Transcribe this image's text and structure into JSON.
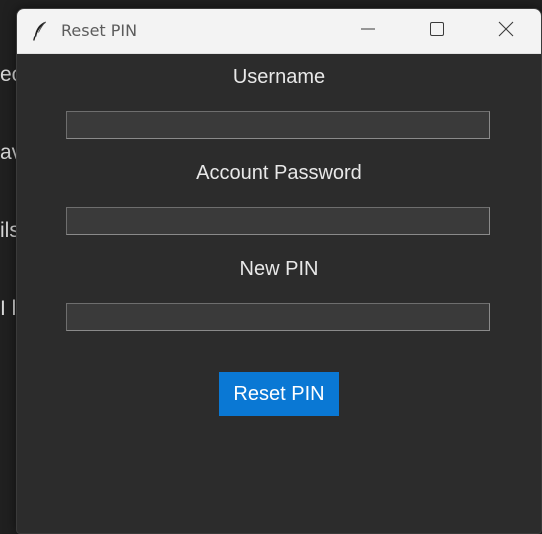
{
  "background": {
    "text_lines": [
      "ec",
      "av",
      "ils",
      "I l"
    ]
  },
  "window": {
    "title": "Reset PIN",
    "app_icon": "feather-icon",
    "controls": {
      "minimize": "minimize-icon",
      "maximize": "maximize-icon",
      "close": "close-icon"
    }
  },
  "form": {
    "username_label": "Username",
    "username_value": "",
    "password_label": "Account Password",
    "password_value": "",
    "pin_label": "New PIN",
    "pin_value": "",
    "submit_label": "Reset PIN"
  },
  "colors": {
    "window_bg": "#2c2c2c",
    "titlebar_bg": "#f3f3f3",
    "accent": "#0a78d4",
    "field_bg": "#3a3a3a",
    "text": "#e8e8e8"
  }
}
